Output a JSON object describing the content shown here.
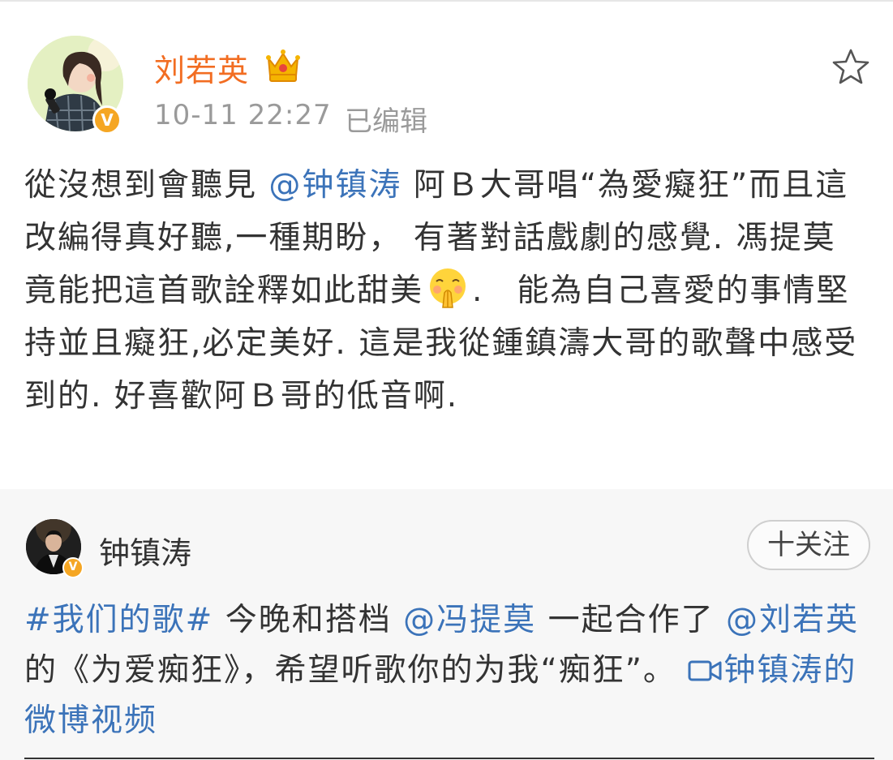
{
  "post": {
    "author": "刘若英",
    "time": "10-11 22:27",
    "edited": "已编辑",
    "body": {
      "t1": "從沒想到會聽見 ",
      "mention1": "@钟镇涛",
      "t2": " 阿Ｂ大哥唱“為愛癡狂”而且這改編得真好聽,一種期盼， 有著對話戲劇的感覺. 馮提莫竟能把這首歌詮釋如此甜美",
      "t3": ".　能為自己喜愛的事情堅持並且癡狂,必定美好.  這是我從鍾鎮濤大哥的歌聲中感受到的. 好喜歡阿Ｂ哥的低音啊."
    }
  },
  "repost": {
    "author": "钟镇涛",
    "follow_label": "十关注",
    "body": {
      "topic": "#我们的歌#",
      "t1": " 今晚和搭档 ",
      "mention1": "@冯提莫",
      "t2": " 一起合作了 ",
      "mention2": "@刘若英",
      "t3": " 的《为爱痴狂》，希望听歌你的为我“痴狂”。 ",
      "video_link": "钟镇涛的微博视频"
    }
  },
  "icons": {
    "crown": "crown-icon",
    "star": "star-icon",
    "verified": "verified-badge-icon",
    "emoji": "praying-hands-emoji",
    "video": "video-camera-icon"
  },
  "colors": {
    "author_name": "#f26d22",
    "link": "#3b73b9",
    "meta_gray": "#9a9a9a",
    "badge": "#f5a623",
    "card_bg": "#f7f7f7"
  }
}
